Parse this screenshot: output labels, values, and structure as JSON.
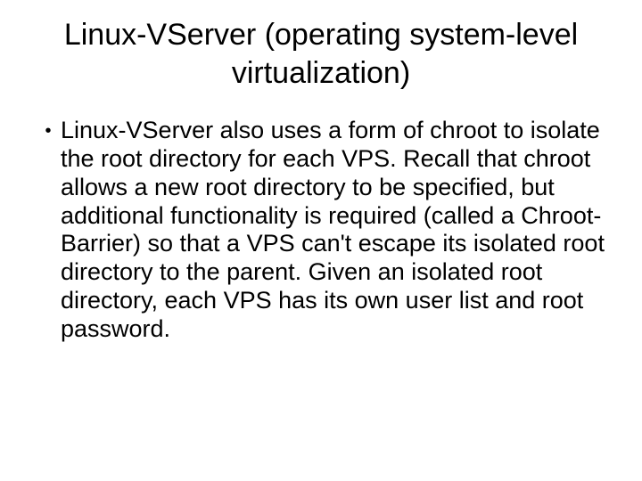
{
  "slide": {
    "title": "Linux-VServer (operating system-level virtualization)",
    "bullets": [
      "Linux-VServer also uses a form of chroot to isolate the root directory for each VPS. Recall that chroot allows a new root directory to be specified, but additional functionality is required (called a Chroot-Barrier) so that a VPS can't escape its isolated root directory to the parent. Given an isolated root directory, each VPS has its own user list and root password."
    ]
  }
}
